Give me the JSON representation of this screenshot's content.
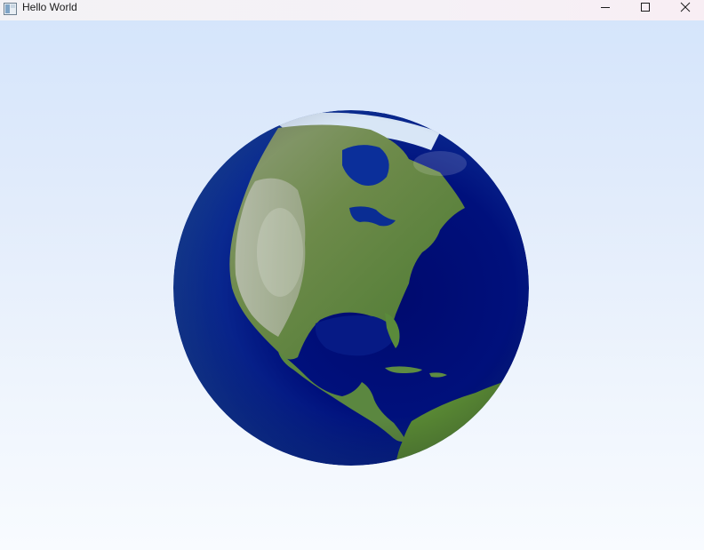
{
  "window": {
    "title": "Hello World",
    "app_icon": "window-app-icon",
    "controls": {
      "minimize": "minimize-icon",
      "maximize": "maximize-icon",
      "close": "close-icon"
    }
  },
  "scene": {
    "object": "earth-globe",
    "colors": {
      "ocean_deep": "#000c78",
      "ocean_mid": "#0d2f9a",
      "land_green": "#4f7b35",
      "land_light": "#a9b394",
      "ice": "#d8e6f6",
      "background_top": "#d5e5fb",
      "background_bottom": "#f8fbff"
    }
  }
}
